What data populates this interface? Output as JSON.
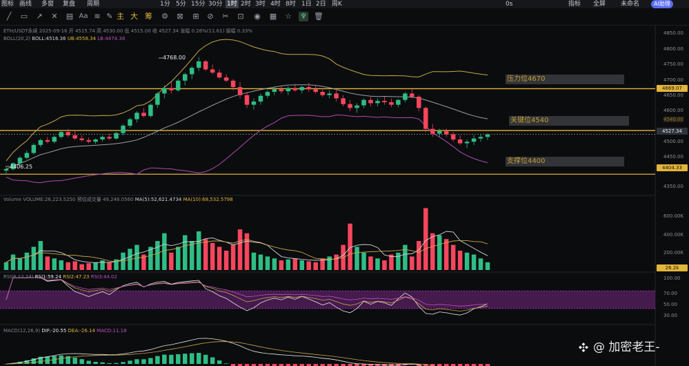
{
  "topbar": {
    "items": [
      "图标",
      "画线",
      "多窗",
      "复盘",
      "周期",
      "1分",
      "5分",
      "15分",
      "30分",
      "1时",
      "2时",
      "3时",
      "4时",
      "8时",
      "1日",
      "2日",
      "周K"
    ],
    "active": "1时",
    "right_items": [
      "0s",
      "指标",
      "全屏",
      "未命名"
    ],
    "badge": "AI助理"
  },
  "toolbar": {
    "text_items": [
      "主",
      "大",
      "筹"
    ],
    "font_label": "Aa"
  },
  "legend": {
    "symbol": "ETH/USDT永续",
    "date": "2025-09-16",
    "open": "开 4515.74",
    "high": "高 4530.00",
    "low": "低 4515.00",
    "close": "收 4527.34",
    "change": "涨幅 0.26%(11.61)",
    "amplitude": "振幅 0.33%",
    "boll_name": "BOLL(20,2)",
    "boll_mid": "BOLL:4516.36",
    "boll_ub": "UB:4558.34",
    "boll_lb": "LB:4474.38",
    "vol_name": "Volume",
    "vol_value": "VOLUME:26,223.5250",
    "vol_est": "预估成交量 49,246.0560",
    "vol_ma5": "MA(5):52,621.4734",
    "vol_ma10": "MA(10):68,532.5798",
    "rsi_name": "RSI(6,12,24)",
    "rsi1": "RSI1:59.24",
    "rsi2": "RSI2:47.23",
    "rsi3": "RSI3:44.02",
    "macd_name": "MACD(12,26,9)",
    "dif": "DIF:-20.55",
    "dea": "DEA:-26.14",
    "macd": "MACD:11.18"
  },
  "price_axis": {
    "labels": [
      "4850.00",
      "4800.00",
      "4750.00",
      "4700.00",
      "4650.00",
      "4600.00",
      "4550.00",
      "4500.00",
      "4450.00",
      "4400.00",
      "4350.00"
    ],
    "tags": [
      {
        "text": "4669.07",
        "bg": "#e3b53a",
        "fg": "#111111"
      },
      {
        "text": "4527.34",
        "bg": "#2f343c",
        "fg": "#e9e9e9"
      },
      {
        "text": "4404.33",
        "bg": "#e3b53a",
        "fg": "#111111"
      }
    ],
    "hidden_tag": "4540.00"
  },
  "annotations": {
    "high": "4768.00",
    "low": "4406.25"
  },
  "levels": [
    {
      "label": "压力位4670",
      "price": 4670
    },
    {
      "label": "关键位4540",
      "price": 4540
    },
    {
      "label": "支撑位4400",
      "price": 4404
    }
  ],
  "volume_axis": {
    "labels": [
      "600.00K",
      "400.00K",
      "200.00K"
    ],
    "tag": "26.2k"
  },
  "rsi_axis": {
    "labels": [
      "100.00",
      "70.00",
      "50.00",
      "30.00"
    ]
  },
  "watermark": "@ 加密老王-",
  "colors": {
    "up": "#2ebd85",
    "down": "#f6465d",
    "level": "#e3b53a",
    "ub": "#c9a94a",
    "lb": "#b14bb5",
    "mid": "#9aa0a6"
  },
  "chart_data": {
    "type": "candlestick",
    "interval": "1时",
    "ohlc": [
      [
        4415,
        4425,
        4406,
        4420
      ],
      [
        4420,
        4440,
        4415,
        4438
      ],
      [
        4438,
        4460,
        4430,
        4455
      ],
      [
        4455,
        4478,
        4450,
        4470
      ],
      [
        4470,
        4500,
        4465,
        4495
      ],
      [
        4495,
        4515,
        4488,
        4510
      ],
      [
        4510,
        4520,
        4500,
        4505
      ],
      [
        4505,
        4525,
        4500,
        4520
      ],
      [
        4520,
        4540,
        4515,
        4535
      ],
      [
        4535,
        4545,
        4520,
        4525
      ],
      [
        4525,
        4540,
        4510,
        4515
      ],
      [
        4515,
        4525,
        4505,
        4510
      ],
      [
        4510,
        4518,
        4500,
        4505
      ],
      [
        4505,
        4515,
        4498,
        4512
      ],
      [
        4512,
        4525,
        4505,
        4520
      ],
      [
        4520,
        4530,
        4510,
        4515
      ],
      [
        4515,
        4535,
        4512,
        4532
      ],
      [
        4532,
        4560,
        4525,
        4555
      ],
      [
        4555,
        4580,
        4548,
        4575
      ],
      [
        4575,
        4600,
        4565,
        4595
      ],
      [
        4595,
        4610,
        4580,
        4585
      ],
      [
        4585,
        4625,
        4580,
        4620
      ],
      [
        4620,
        4660,
        4610,
        4655
      ],
      [
        4655,
        4680,
        4640,
        4672
      ],
      [
        4672,
        4690,
        4655,
        4665
      ],
      [
        4665,
        4700,
        4660,
        4695
      ],
      [
        4695,
        4720,
        4680,
        4715
      ],
      [
        4715,
        4740,
        4700,
        4735
      ],
      [
        4735,
        4768,
        4725,
        4755
      ],
      [
        4755,
        4760,
        4725,
        4730
      ],
      [
        4730,
        4745,
        4715,
        4720
      ],
      [
        4720,
        4730,
        4700,
        4705
      ],
      [
        4705,
        4715,
        4690,
        4695
      ],
      [
        4695,
        4700,
        4665,
        4675
      ],
      [
        4675,
        4690,
        4640,
        4650
      ],
      [
        4650,
        4660,
        4610,
        4620
      ],
      [
        4620,
        4640,
        4605,
        4630
      ],
      [
        4630,
        4655,
        4620,
        4648
      ],
      [
        4648,
        4665,
        4640,
        4660
      ],
      [
        4660,
        4675,
        4650,
        4668
      ],
      [
        4668,
        4680,
        4655,
        4662
      ],
      [
        4662,
        4678,
        4650,
        4672
      ],
      [
        4672,
        4685,
        4660,
        4665
      ],
      [
        4665,
        4680,
        4655,
        4675
      ],
      [
        4675,
        4688,
        4660,
        4668
      ],
      [
        4668,
        4680,
        4655,
        4660
      ],
      [
        4660,
        4672,
        4645,
        4650
      ],
      [
        4650,
        4665,
        4640,
        4655
      ],
      [
        4655,
        4665,
        4630,
        4640
      ],
      [
        4640,
        4650,
        4615,
        4622
      ],
      [
        4622,
        4635,
        4600,
        4610
      ],
      [
        4610,
        4625,
        4595,
        4618
      ],
      [
        4618,
        4640,
        4610,
        4635
      ],
      [
        4635,
        4645,
        4615,
        4625
      ],
      [
        4625,
        4640,
        4615,
        4632
      ],
      [
        4632,
        4645,
        4620,
        4628
      ],
      [
        4628,
        4640,
        4612,
        4620
      ],
      [
        4620,
        4638,
        4612,
        4635
      ],
      [
        4635,
        4660,
        4628,
        4655
      ],
      [
        4655,
        4668,
        4640,
        4645
      ],
      [
        4645,
        4650,
        4600,
        4610
      ],
      [
        4610,
        4615,
        4535,
        4545
      ],
      [
        4545,
        4560,
        4520,
        4530
      ],
      [
        4530,
        4545,
        4520,
        4538
      ],
      [
        4538,
        4545,
        4520,
        4528
      ],
      [
        4528,
        4535,
        4505,
        4512
      ],
      [
        4512,
        4525,
        4495,
        4500
      ],
      [
        4500,
        4512,
        4485,
        4505
      ],
      [
        4505,
        4525,
        4495,
        4515
      ],
      [
        4515,
        4528,
        4505,
        4520
      ],
      [
        4520,
        4532,
        4510,
        4527
      ]
    ],
    "volume": [
      40,
      80,
      60,
      90,
      120,
      150,
      70,
      60,
      50,
      40,
      45,
      30,
      35,
      40,
      50,
      40,
      55,
      90,
      110,
      130,
      80,
      120,
      150,
      190,
      90,
      120,
      180,
      150,
      200,
      160,
      140,
      120,
      100,
      130,
      210,
      190,
      90,
      80,
      70,
      60,
      50,
      55,
      60,
      50,
      45,
      40,
      60,
      70,
      80,
      130,
      240,
      120,
      90,
      70,
      60,
      50,
      80,
      90,
      130,
      70,
      150,
      320,
      190,
      180,
      160,
      130,
      100,
      90,
      80,
      60,
      40
    ],
    "price_axis_range": [
      4340,
      4860
    ],
    "volume_axis_labels": [
      "600.00K",
      "400.00K",
      "200.00K"
    ],
    "rsi_axis_labels": [
      "100.00",
      "70.00",
      "50.00",
      "30.00"
    ]
  }
}
